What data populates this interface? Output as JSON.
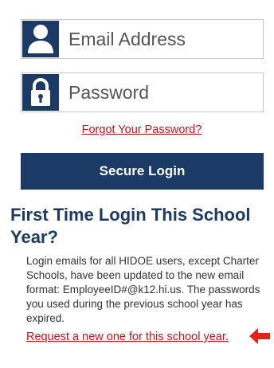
{
  "login_form": {
    "email_placeholder": "Email Address",
    "password_placeholder": "Password",
    "forgot_password_link": "Forgot Your Password?",
    "submit_label": "Secure Login"
  },
  "first_time": {
    "heading": "First Time Login This School Year?",
    "body": "Login emails for all HIDOE users, except Charter Schools, have been updated to the new email format: EmployeeID#@k12.hi.us. The passwords you used during the previous school year has expired.",
    "request_link": "Request a new one for this school year."
  },
  "icons": {
    "email_field": "user-icon",
    "password_field": "lock-icon",
    "request_pointer": "left-arrow-icon"
  },
  "colors": {
    "brand_navy": "#1b3a66",
    "link_red": "#c0141b",
    "arrow_red": "#e2231a"
  }
}
